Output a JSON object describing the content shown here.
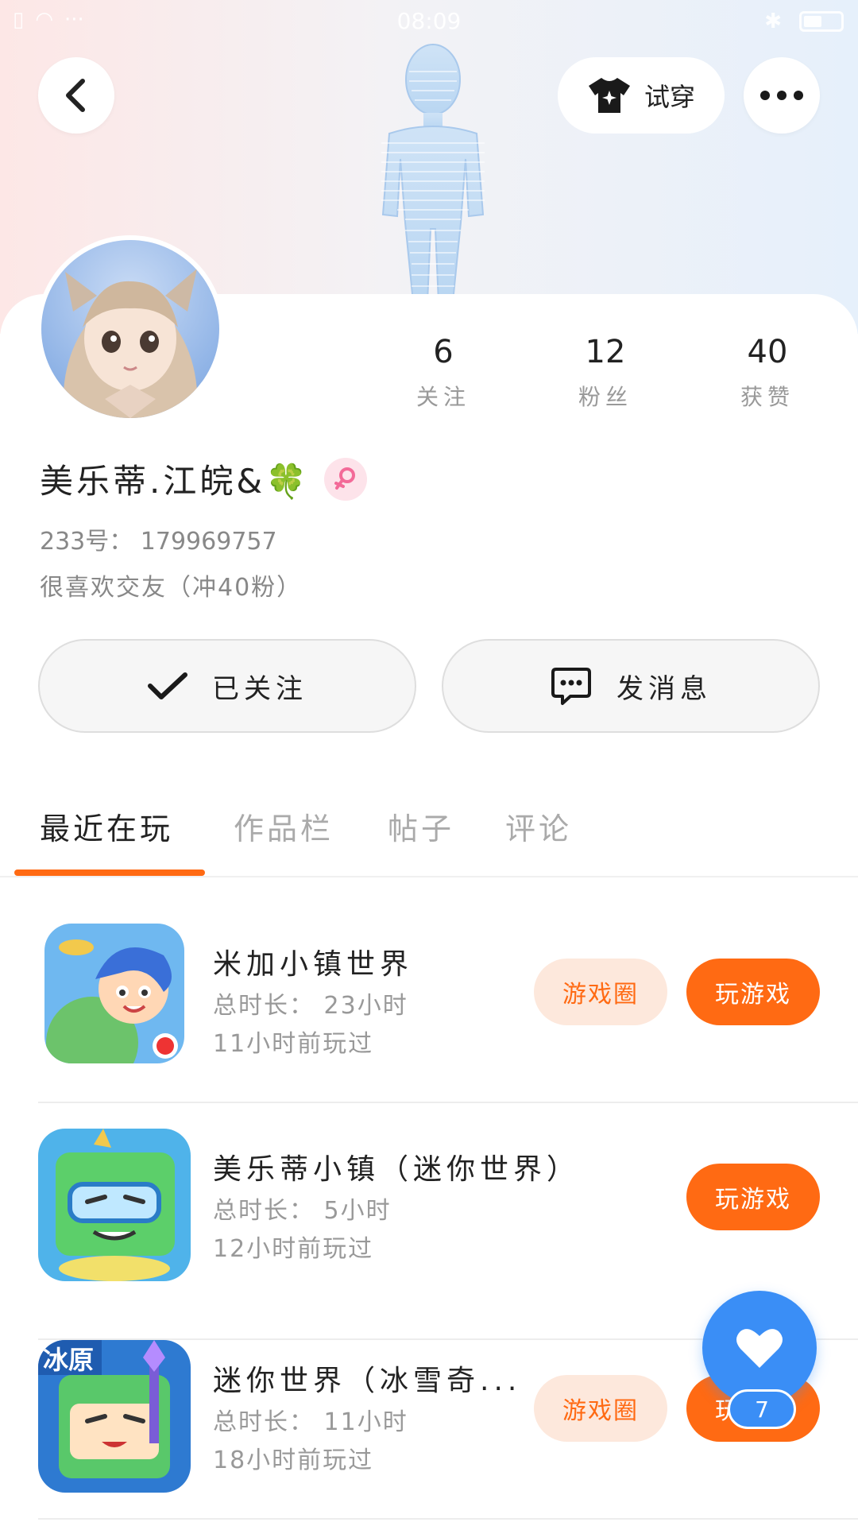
{
  "status_bar": {
    "time": "08:09"
  },
  "header": {
    "try_on_label": "试穿"
  },
  "profile": {
    "name": "美乐蒂.江皖&🍀",
    "uid": "233号： 179969757",
    "bio": "很喜欢交友（冲40粉）",
    "stats": [
      {
        "value": "6",
        "label": "关注"
      },
      {
        "value": "12",
        "label": "粉丝"
      },
      {
        "value": "40",
        "label": "获赞"
      }
    ]
  },
  "actions": {
    "followed_label": "已关注",
    "message_label": "发消息"
  },
  "tabs": [
    {
      "label": "最近在玩",
      "active": true
    },
    {
      "label": "作品栏",
      "active": false
    },
    {
      "label": "帖子",
      "active": false
    },
    {
      "label": "评论",
      "active": false
    }
  ],
  "games": [
    {
      "title": "米加小镇世界",
      "total_time": "总时长： 23小时",
      "last_played": "11小时前玩过",
      "circle_label": "游戏圈",
      "play_label": "玩游戏"
    },
    {
      "title": "美乐蒂小镇（迷你世界）",
      "total_time": "总时长： 5小时",
      "last_played": "12小时前玩过",
      "play_label": "玩游戏"
    },
    {
      "title": "迷你世界（冰雪奇...",
      "total_time": "总时长： 11小时",
      "last_played": "18小时前玩过",
      "circle_label": "游戏圈",
      "play_label": "玩游戏",
      "icon_text": "冰原"
    }
  ],
  "fab": {
    "count": "7"
  },
  "colors": {
    "accent": "#ff6a13",
    "accent_light": "#fde8dc",
    "fab_blue": "#3a8ef6"
  }
}
